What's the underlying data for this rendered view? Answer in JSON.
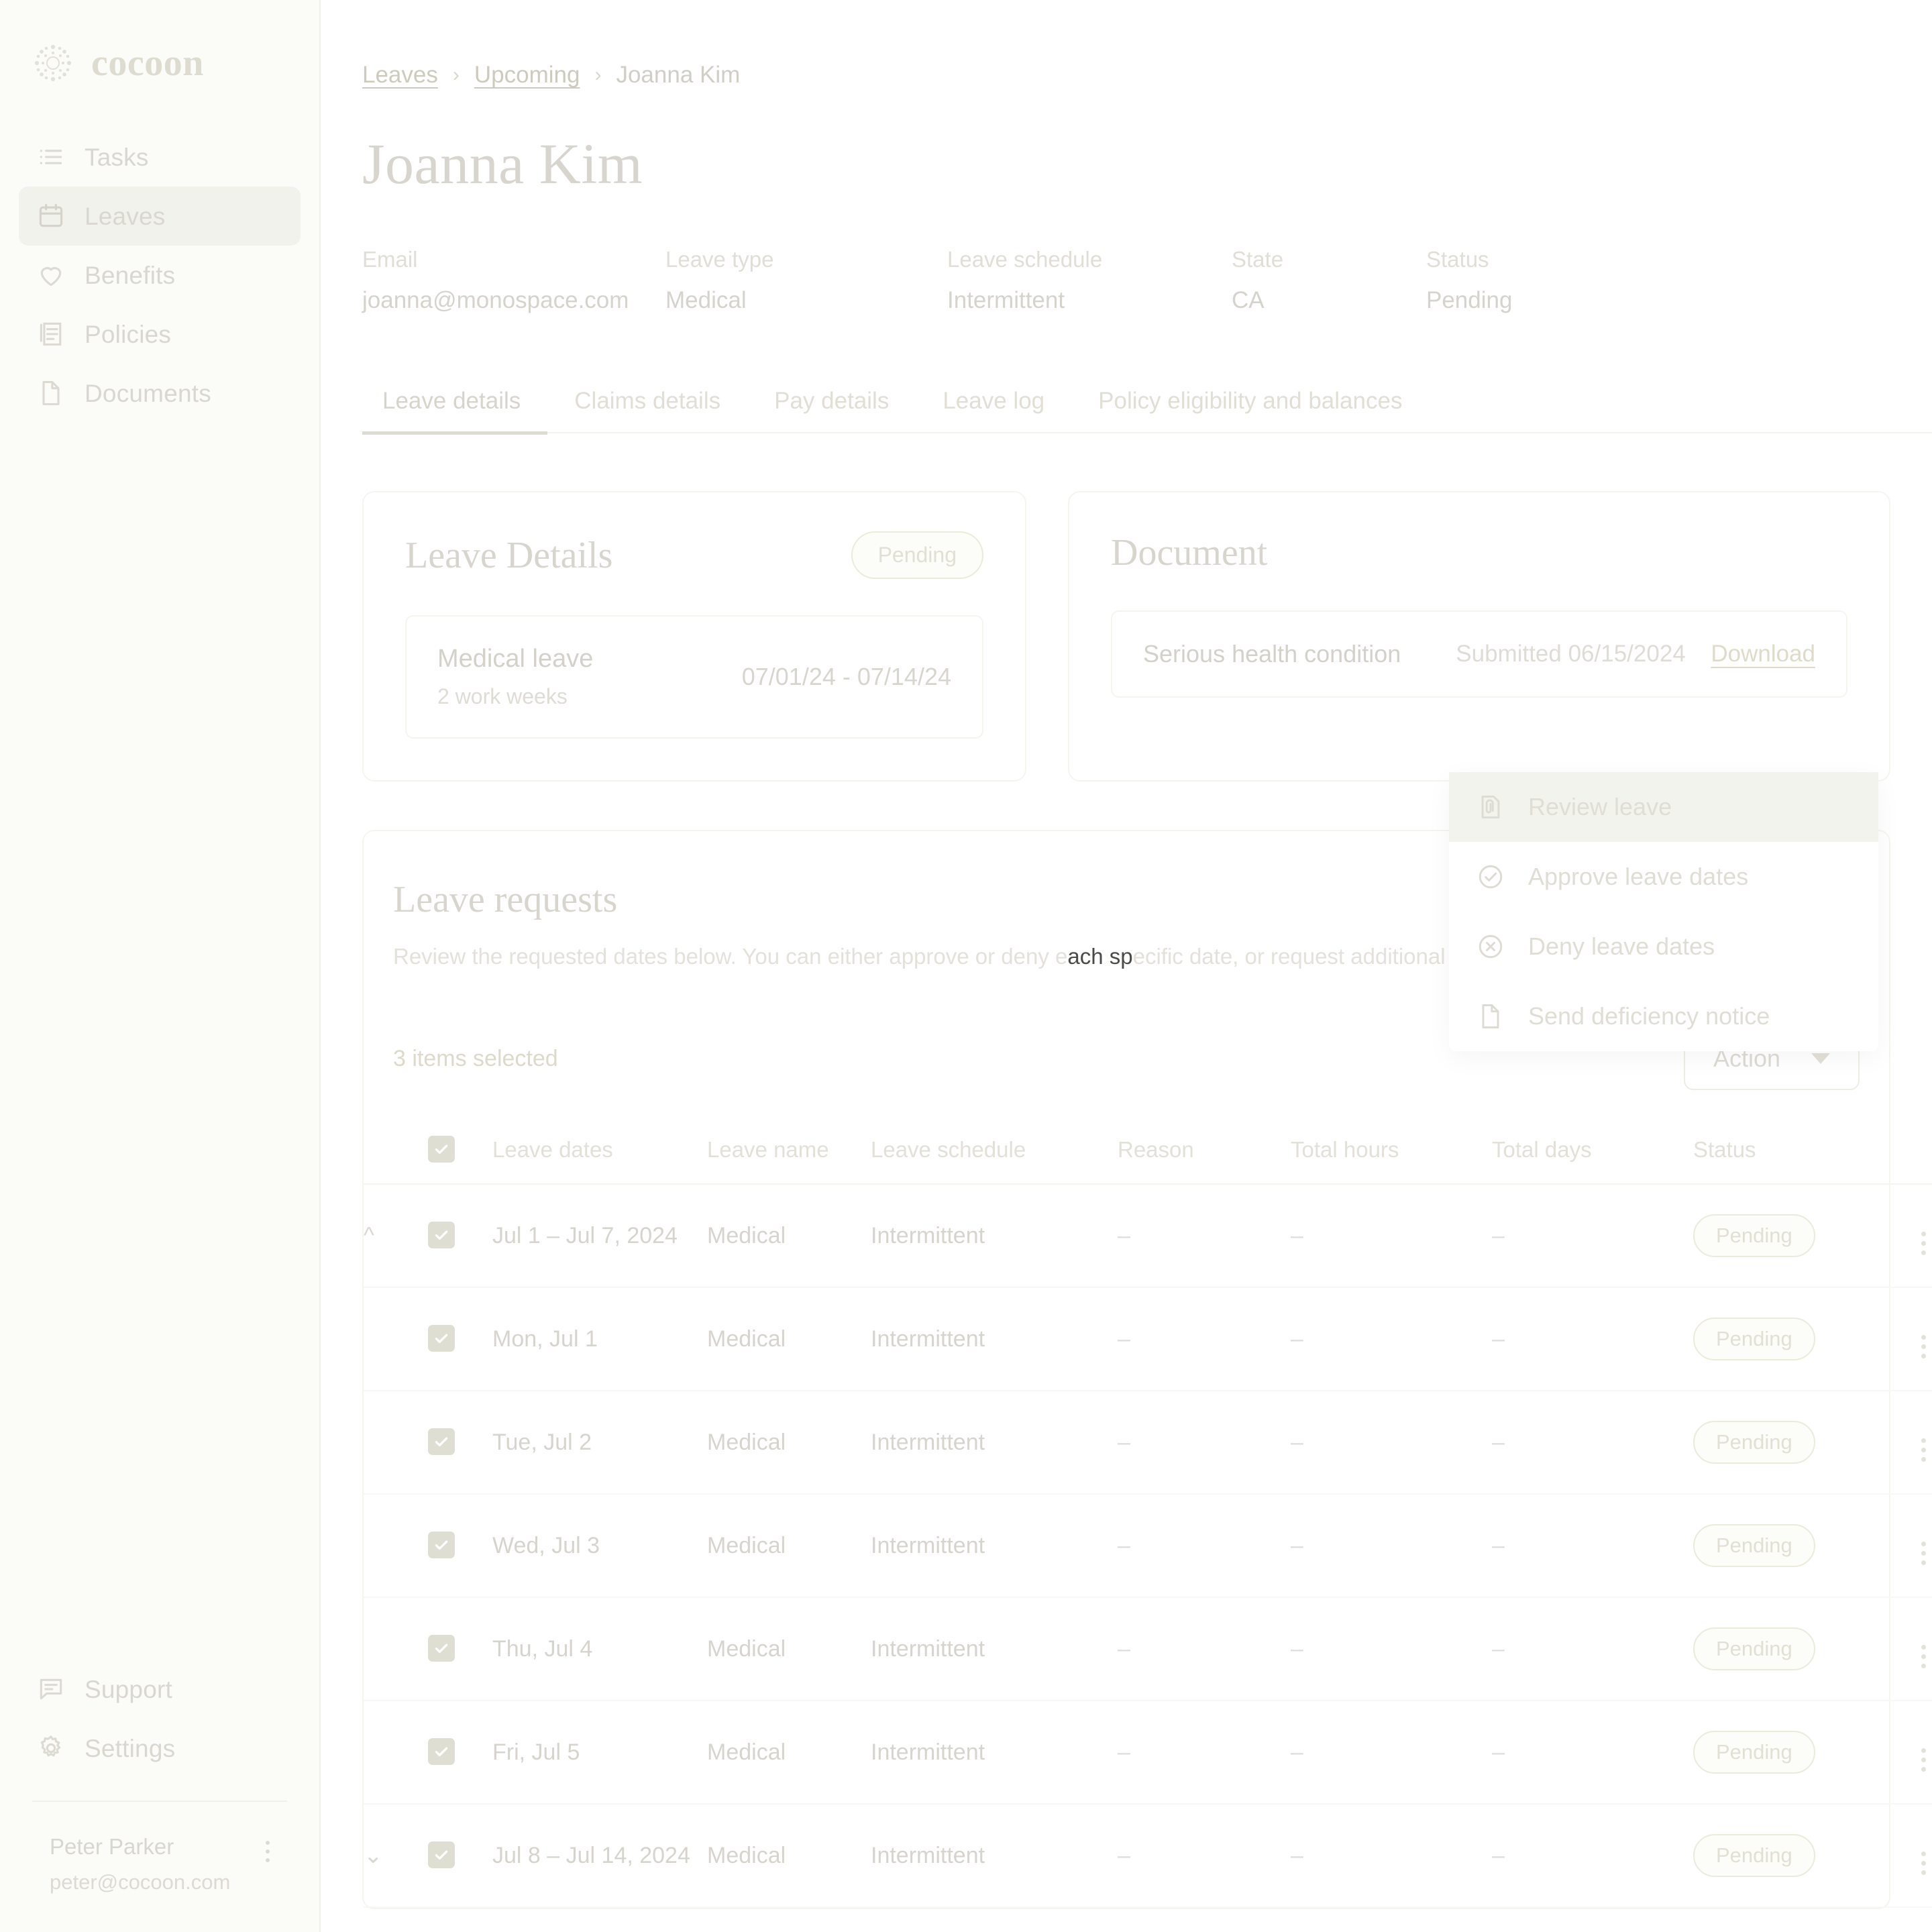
{
  "brand": {
    "name": "cocoon",
    "logo_icon": "cocoon-sunburst-logo"
  },
  "sidebar": {
    "items": [
      {
        "label": "Tasks",
        "icon": "list-icon",
        "active": false
      },
      {
        "label": "Leaves",
        "icon": "calendar-icon",
        "active": true
      },
      {
        "label": "Benefits",
        "icon": "heart-icon",
        "active": false
      },
      {
        "label": "Policies",
        "icon": "policies-icon",
        "active": false
      },
      {
        "label": "Documents",
        "icon": "document-icon",
        "active": false
      }
    ],
    "bottom_items": [
      {
        "label": "Support",
        "icon": "chat-icon"
      },
      {
        "label": "Settings",
        "icon": "gear-icon"
      }
    ],
    "user": {
      "name": "Peter Parker",
      "email": "peter@cocoon.com",
      "menu_icon": "kebab-menu-icon"
    }
  },
  "breadcrumb": {
    "items": [
      "Leaves",
      "Upcoming",
      "Joanna Kim"
    ],
    "separator": "›"
  },
  "page": {
    "title": "Joanna Kim"
  },
  "meta": [
    {
      "label": "Email",
      "value": "joanna@monospace.com"
    },
    {
      "label": "Leave type",
      "value": "Medical"
    },
    {
      "label": "Leave schedule",
      "value": "Intermittent"
    },
    {
      "label": "State",
      "value": "CA"
    },
    {
      "label": "Status",
      "value": "Pending"
    }
  ],
  "tabs": [
    {
      "label": "Leave details",
      "active": true
    },
    {
      "label": "Claims details",
      "active": false
    },
    {
      "label": "Pay details",
      "active": false
    },
    {
      "label": "Leave log",
      "active": false
    },
    {
      "label": "Policy eligibility and balances",
      "active": false
    }
  ],
  "leave_details": {
    "title": "Leave Details",
    "status_badge": "Pending",
    "entry": {
      "name": "Medical leave",
      "sub": "2 work weeks",
      "dates": "07/01/24 - 07/14/24"
    }
  },
  "document": {
    "title": "Document",
    "entry": {
      "name": "Serious health condition",
      "submitted": "Submitted 06/15/2024",
      "download_label": "Download"
    }
  },
  "requests": {
    "title": "Leave requests",
    "description_pre": "Review the requested dates below. You can either approve or deny e",
    "description_hl": "ach sp",
    "description_post": "ecific date, or request additional information.",
    "selected_text": "3 items selected",
    "action_button": "Action",
    "columns": [
      "Leave dates",
      "Leave name",
      "Leave schedule",
      "Reason",
      "Total hours",
      "Total days",
      "Status"
    ],
    "rows": [
      {
        "expander": "chevron-up-icon",
        "checked": true,
        "dates": "Jul 1 – Jul 7, 2024",
        "name": "Medical",
        "schedule": "Intermittent",
        "reason": "–",
        "total_hours": "–",
        "total_days": "–",
        "status": "Pending",
        "indent": false
      },
      {
        "expander": "",
        "checked": true,
        "dates": "Mon, Jul 1",
        "name": "Medical",
        "schedule": "Intermittent",
        "reason": "–",
        "total_hours": "–",
        "total_days": "–",
        "status": "Pending",
        "indent": true
      },
      {
        "expander": "",
        "checked": true,
        "dates": "Tue, Jul 2",
        "name": "Medical",
        "schedule": "Intermittent",
        "reason": "–",
        "total_hours": "–",
        "total_days": "–",
        "status": "Pending",
        "indent": true
      },
      {
        "expander": "",
        "checked": true,
        "dates": "Wed, Jul 3",
        "name": "Medical",
        "schedule": "Intermittent",
        "reason": "–",
        "total_hours": "–",
        "total_days": "–",
        "status": "Pending",
        "indent": true
      },
      {
        "expander": "",
        "checked": true,
        "dates": "Thu, Jul 4",
        "name": "Medical",
        "schedule": "Intermittent",
        "reason": "–",
        "total_hours": "–",
        "total_days": "–",
        "status": "Pending",
        "indent": true
      },
      {
        "expander": "",
        "checked": true,
        "dates": "Fri, Jul 5",
        "name": "Medical",
        "schedule": "Intermittent",
        "reason": "–",
        "total_hours": "–",
        "total_days": "–",
        "status": "Pending",
        "indent": true
      },
      {
        "expander": "chevron-down-icon",
        "checked": true,
        "dates": "Jul 8 – Jul 14, 2024",
        "name": "Medical",
        "schedule": "Intermittent",
        "reason": "–",
        "total_hours": "–",
        "total_days": "–",
        "status": "Pending",
        "indent": false
      }
    ]
  },
  "action_menu": {
    "open": true,
    "items": [
      {
        "label": "Review leave",
        "icon": "document-attachment-icon",
        "hovered": true
      },
      {
        "label": "Approve leave dates",
        "icon": "check-circle-icon",
        "hovered": false
      },
      {
        "label": "Deny leave dates",
        "icon": "x-circle-icon",
        "hovered": false
      },
      {
        "label": "Send deficiency notice",
        "icon": "file-icon",
        "hovered": false
      }
    ]
  },
  "colors": {
    "page_bg": "#ffffff",
    "sidebar_bg": "#fbfbf8",
    "sidebar_active_bg": "#f2f2ec",
    "text_muted": "#d6d4cc",
    "text_faint": "#e2e0d7",
    "border": "#f5f5f0",
    "checkbox_fill": "#dfded2",
    "menu_hover_bg": "#f3f3ed",
    "highlight_text": "#4a4a46"
  }
}
